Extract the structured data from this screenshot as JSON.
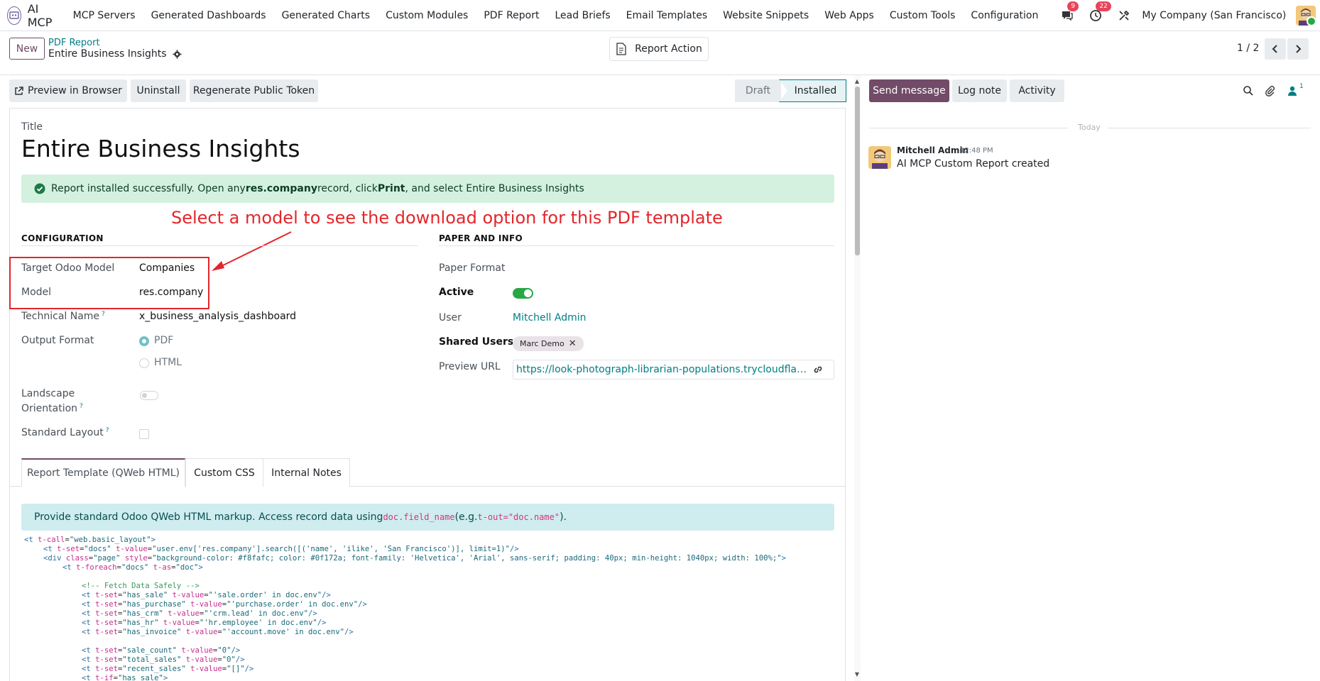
{
  "app": {
    "name": "AI MCP",
    "menu": [
      "MCP Servers",
      "Generated Dashboards",
      "Generated Charts",
      "Custom Modules",
      "PDF Report",
      "Lead Briefs",
      "Email Templates",
      "Website Snippets",
      "Web Apps",
      "Custom Tools",
      "Configuration"
    ],
    "messages_badge": "9",
    "activities_badge": "22",
    "company": "My Company (San Francisco)"
  },
  "control": {
    "new_label": "New",
    "breadcrumb": "PDF Report",
    "record_name": "Entire Business Insights",
    "report_action": "Report Action",
    "pager": "1 / 2"
  },
  "statusbar": {
    "buttons": [
      "Preview in Browser",
      "Uninstall",
      "Regenerate Public Token"
    ],
    "stages": [
      "Draft",
      "Installed"
    ],
    "active_stage": "Installed"
  },
  "form": {
    "title_label": "Title",
    "title": "Entire Business Insights",
    "alert_prefix": "Report installed successfully. Open any ",
    "alert_model": "res.company",
    "alert_mid": " record, click ",
    "alert_print": "Print",
    "alert_suffix": ", and select Entire Business Insights",
    "annotation": "Select a model to see the download option for this PDF template",
    "config_heading": "CONFIGURATION",
    "paper_heading": "PAPER AND INFO",
    "fields_left": {
      "target_model_label": "Target Odoo Model",
      "target_model_value": "Companies",
      "model_label": "Model",
      "model_value": "res.company",
      "technical_name_label": "Technical Name",
      "technical_name_value": "x_business_analysis_dashboard",
      "output_format_label": "Output Format",
      "output_pdf": "PDF",
      "output_html": "HTML",
      "landscape_label_1": "Landscape",
      "landscape_label_2": "Orientation",
      "standard_layout_label": "Standard Layout",
      "help_mark": "?"
    },
    "fields_right": {
      "paper_format_label": "Paper Format",
      "active_label": "Active",
      "user_label": "User",
      "user_value": "Mitchell Admin",
      "shared_users_label": "Shared Users",
      "shared_user_tag": "Marc Demo",
      "preview_url_label": "Preview URL",
      "preview_url_value": "https://look-photograph-librarian-populations.trycloudflare.com/report/preview"
    },
    "tabs": [
      "Report Template (QWeb HTML)",
      "Custom CSS",
      "Internal Notes"
    ],
    "info_prefix": "Provide standard Odoo QWeb HTML markup. Access record data using ",
    "info_code1": "doc.field_name",
    "info_mid": " (e.g. ",
    "info_code2": "t-out=\"doc.name\"",
    "info_suffix": ")."
  },
  "chatter": {
    "send_message": "Send message",
    "log_note": "Log note",
    "activity": "Activity",
    "followers_count": "1",
    "today": "Today",
    "author": "Mitchell Admin",
    "time": "12:48 PM",
    "body": "AI MCP Custom Report created"
  },
  "colors": {
    "brand": "#714b67",
    "link": "#017e84",
    "annotation": "#e3262b",
    "success_bg": "#d4f1df",
    "info_bg": "#cfecef"
  }
}
